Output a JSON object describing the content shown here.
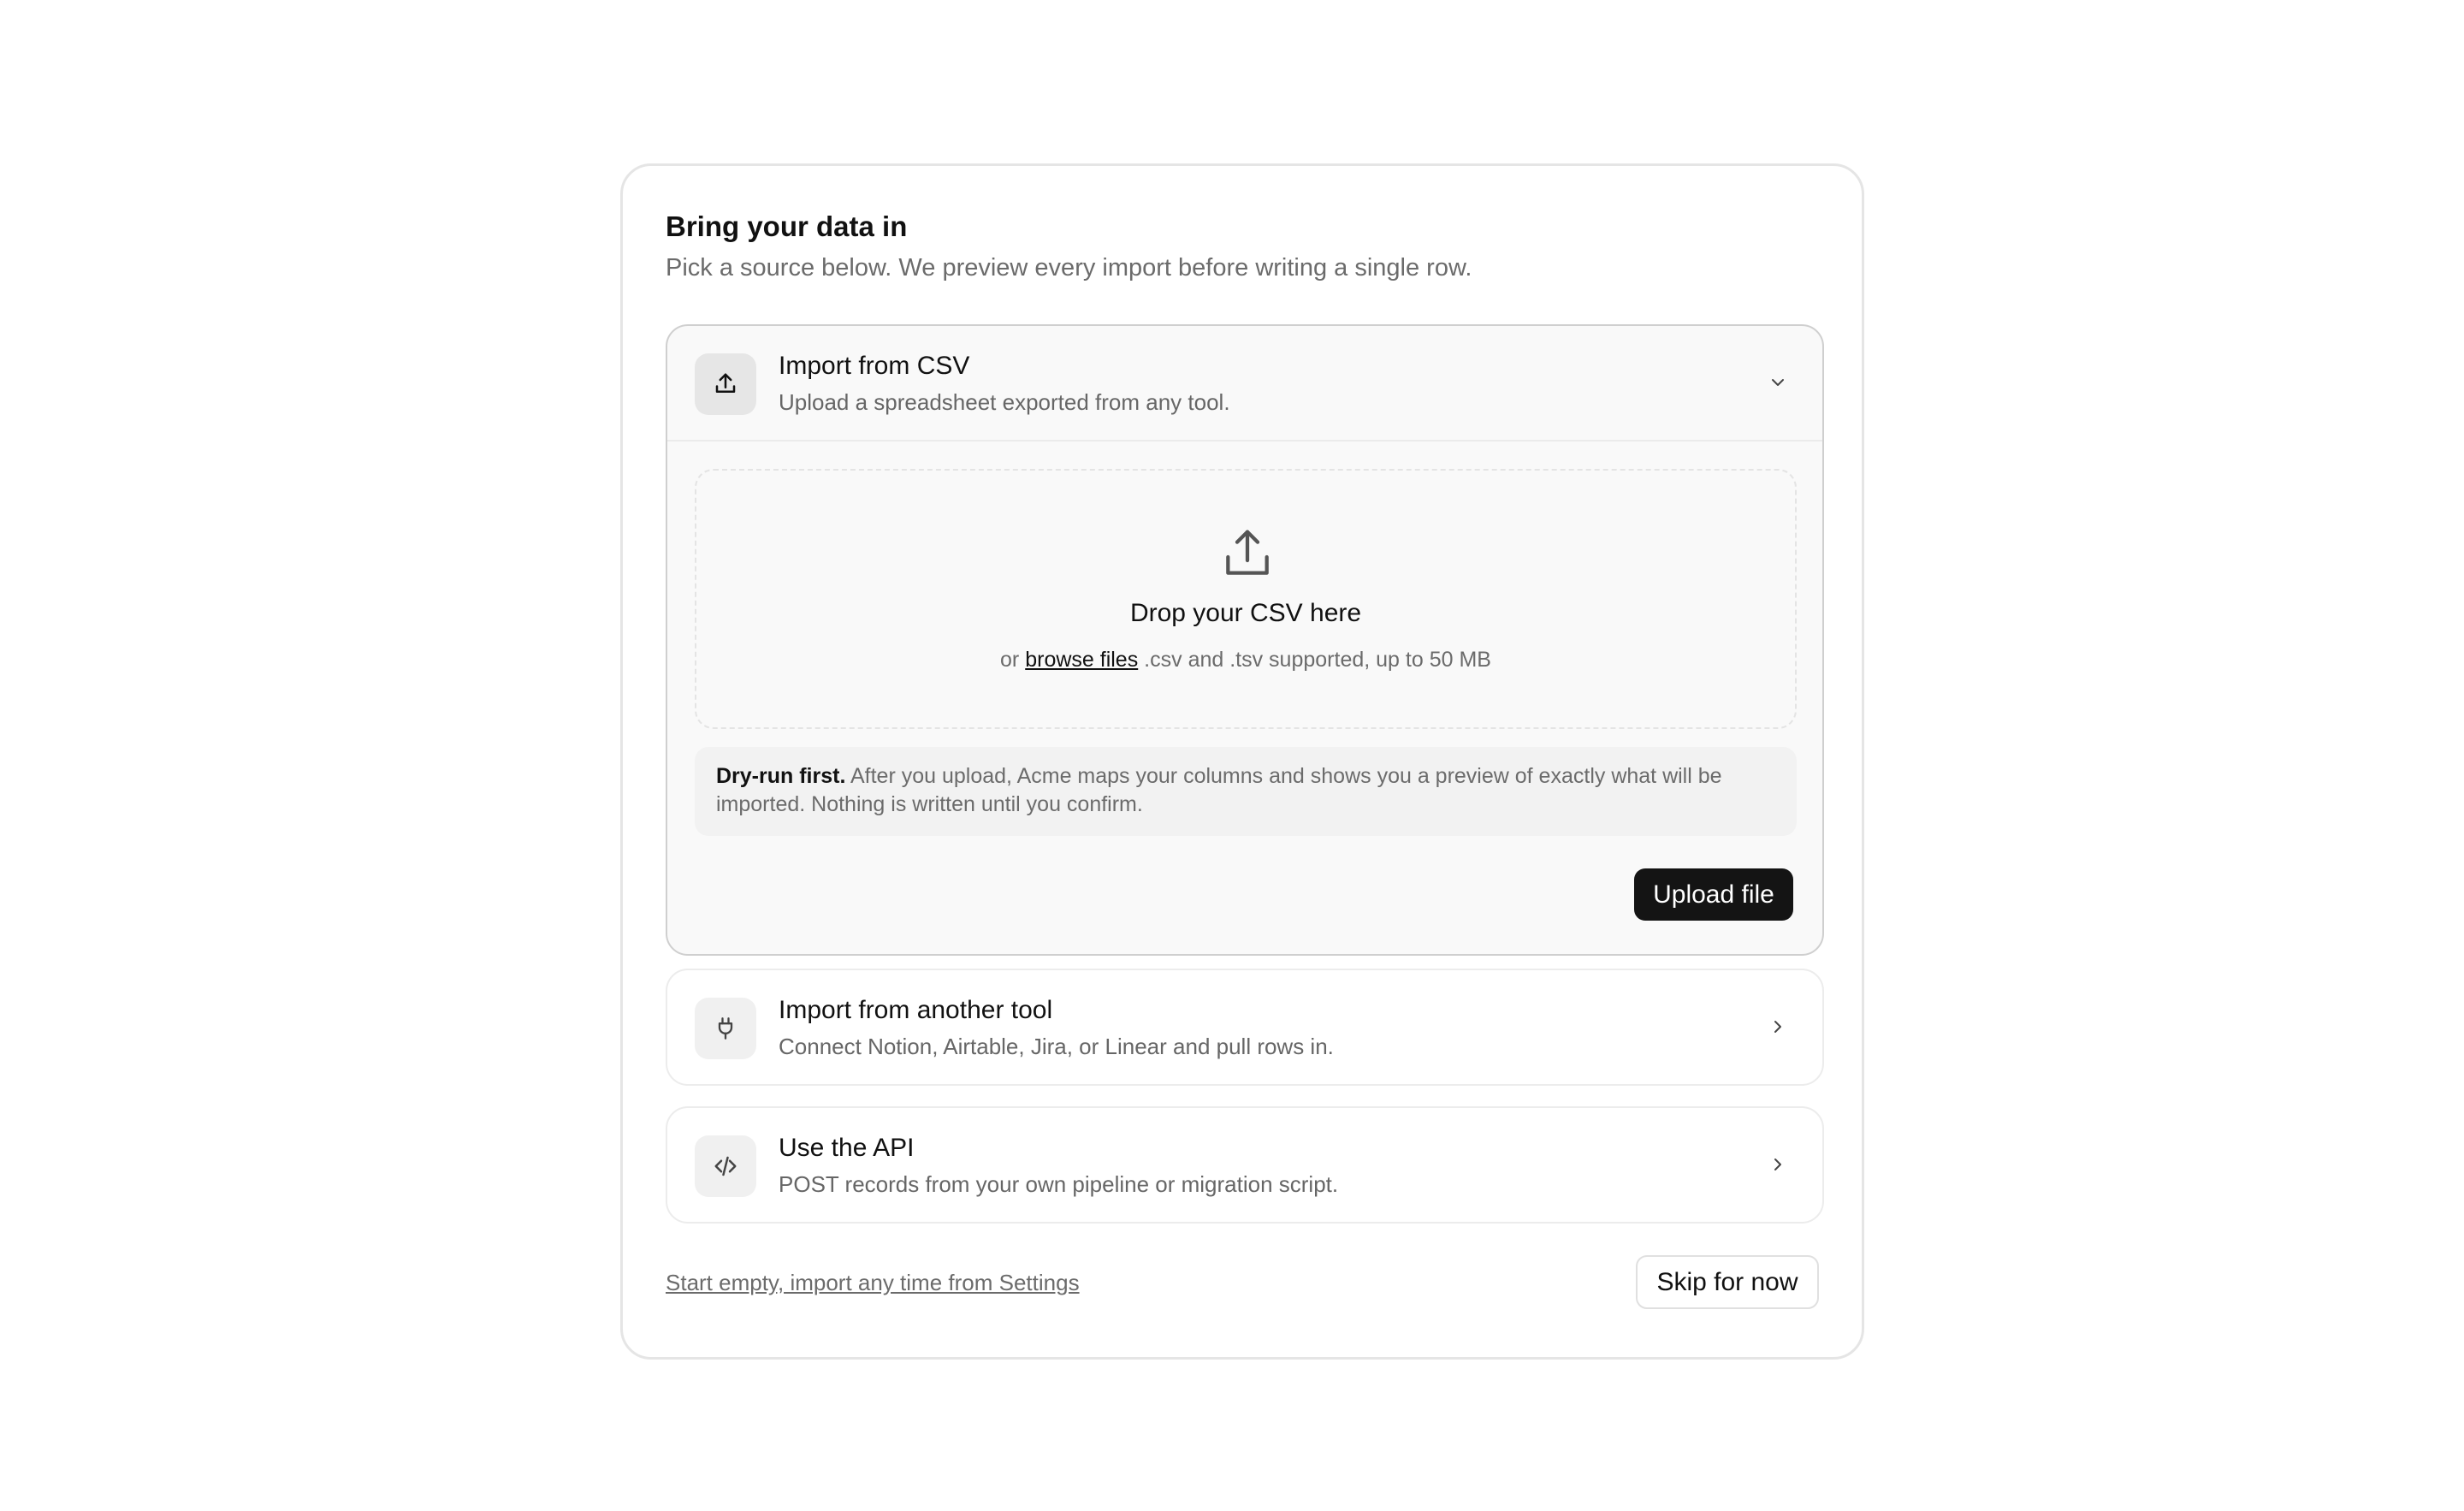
{
  "header": {
    "title": "Bring your data in",
    "subtitle": "Pick a source below. We preview every import before writing a single row."
  },
  "options": [
    {
      "title": "Import from CSV",
      "description": "Upload a spreadsheet exported from any tool.",
      "icon": "upload-icon",
      "state": "expanded",
      "chevron": "chevron-down-icon"
    },
    {
      "title": "Import from another tool",
      "description": "Connect Notion, Airtable, Jira, or Linear and pull rows in.",
      "icon": "plug-icon",
      "state": "collapsed",
      "chevron": "chevron-right-icon"
    },
    {
      "title": "Use the API",
      "description": "POST records from your own pipeline or migration script.",
      "icon": "code-icon",
      "state": "collapsed",
      "chevron": "chevron-right-icon"
    }
  ],
  "dropzone": {
    "title": "Drop your CSV here",
    "prefix": "or",
    "browse_label": "browse files",
    "hint": ".csv and .tsv supported, up to 50 MB"
  },
  "note": {
    "bold": "Dry-run first.",
    "text": "After you upload, Acme maps your columns and shows you a preview of exactly what will be imported. Nothing is written until you confirm."
  },
  "actions": {
    "upload_label": "Upload file",
    "skip_link": "Start empty, import any time from Settings",
    "skip_button": "Skip for now"
  },
  "colors": {
    "primary_button": "#141414",
    "muted_text": "#6b6b6b",
    "border": "#e5e5e5"
  }
}
